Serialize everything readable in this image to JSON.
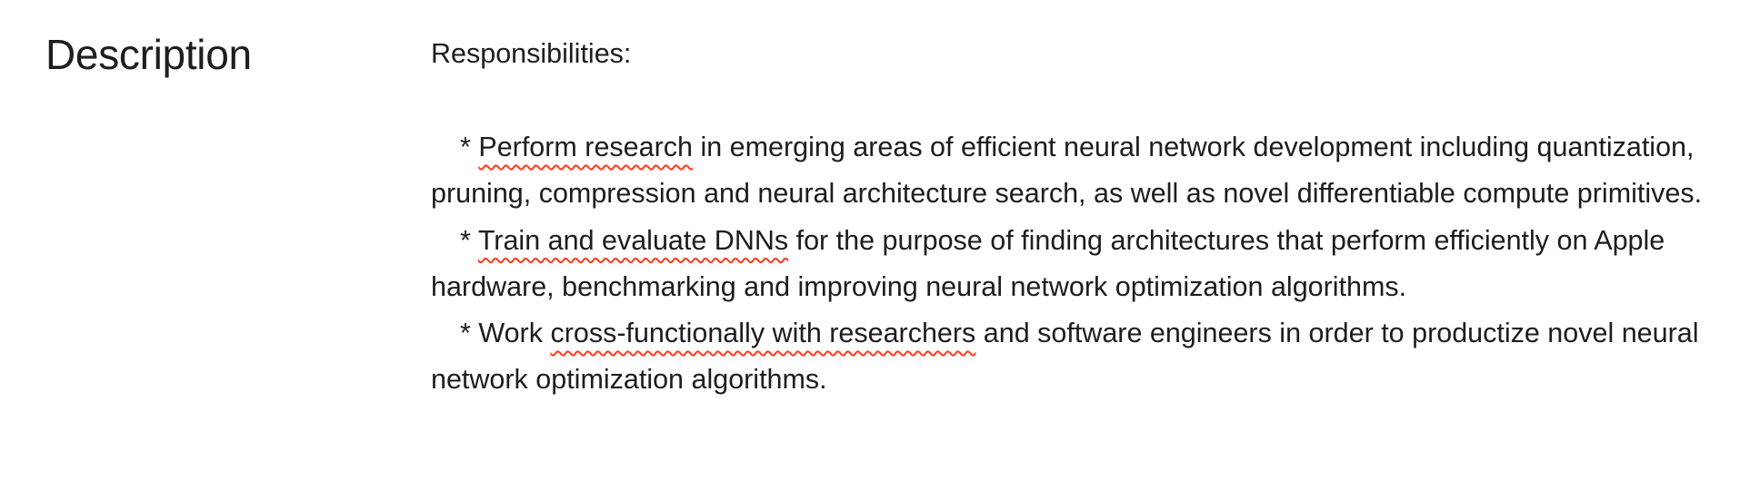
{
  "section": {
    "title": "Description"
  },
  "description": {
    "heading": "Responsibilities:",
    "bullets": [
      {
        "marker": "*",
        "highlight": "Perform research",
        "text": " in emerging areas of efficient neural network development including quantization, pruning, compression and neural architecture search, as well as novel differentiable compute primitives."
      },
      {
        "marker": "*",
        "highlight": "Train and evaluate DNNs",
        "text": " for the purpose of finding architectures that perform efficiently on Apple hardware, benchmarking and improving neural network optimization algorithms."
      },
      {
        "marker": "*",
        "lead": "Work ",
        "highlight": "cross-functionally with researchers",
        "text": " and software engineers in order to productize novel neural network optimization algorithms."
      }
    ]
  },
  "colors": {
    "text": "#1d1d1f",
    "highlight_underline": "#ff3b1f",
    "background": "#ffffff"
  }
}
